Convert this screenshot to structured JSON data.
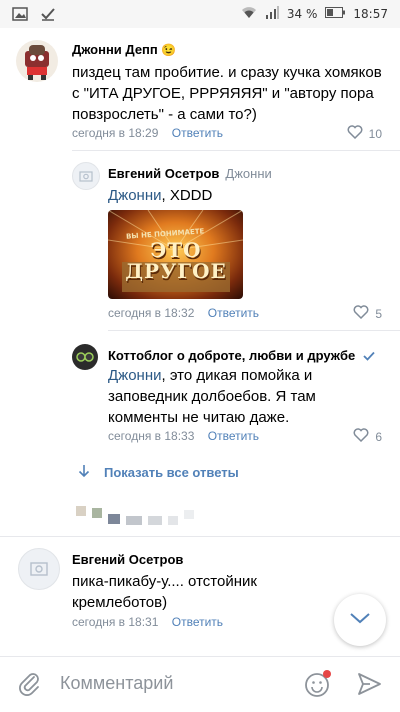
{
  "statusbar": {
    "battery_percent": "34 %",
    "time": "18:57"
  },
  "comments": [
    {
      "author": "Джонни Депп",
      "text": "пиздец там пробитие. и сразу кучка хомяков с \"ИТА ДРУГОЕ, РРРЯЯЯЯ\" и \"автору пора повзрослеть\" - а сами то?)",
      "time": "сегодня в 18:29",
      "reply_label": "Ответить",
      "likes": "10"
    },
    {
      "author": "Евгений Осетров",
      "reply_to": "Джонни",
      "mention": "Джонни",
      "text": ", XDDD",
      "image_caption": "ЭТО ДРУГОЕ",
      "image_top": "ВЫ НЕ ПОНИМАЕТЕ",
      "time": "сегодня в 18:32",
      "reply_label": "Ответить",
      "likes": "5"
    },
    {
      "author": "Коттоблог о доброте, любви и дружбе",
      "mention": "Джонни",
      "text": ", это дикая помойка и заповедник долбоебов. Я там комменты не читаю даже.",
      "time": "сегодня в 18:33",
      "reply_label": "Ответить",
      "likes": "6"
    },
    {
      "author": "Евгений Осетров",
      "text": "пика-пикабу-у.... отстойник кремлеботов)",
      "time": "сегодня в 18:31",
      "reply_label": "Ответить"
    }
  ],
  "show_replies_label": "Показать все ответы",
  "input_placeholder": "Комментарий",
  "colors": {
    "link": "#2a5885",
    "accent": "#5181b8",
    "meta": "#818c99",
    "verified": "#5181b8"
  }
}
